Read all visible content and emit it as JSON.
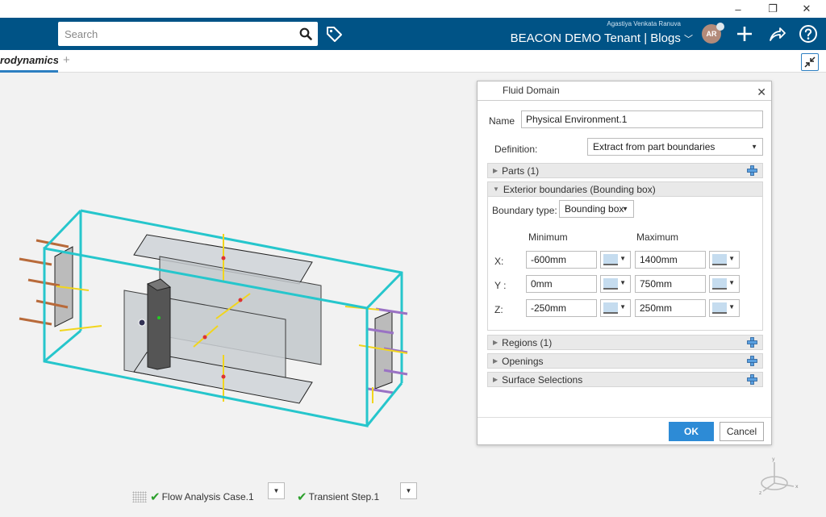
{
  "window": {
    "minimize": "–",
    "maximize": "❐",
    "close": "✕"
  },
  "topbar": {
    "search_placeholder": "Search",
    "user_name": "Agastiya Venkata Ranuva",
    "tenant": "BEACON DEMO Tenant | Blogs",
    "avatar_initials": "AR",
    "accent": "#005386"
  },
  "tabs": {
    "active_label": "rodynamics",
    "add_label": "+"
  },
  "dialog": {
    "title": "Fluid Domain",
    "name_label": "Name",
    "name_value": "Physical Environment.1",
    "definition_label": "Definition:",
    "definition_value": "Extract from part boundaries",
    "sections": {
      "parts": "Parts (1)",
      "exterior": "Exterior boundaries (Bounding box)",
      "regions": "Regions (1)",
      "openings": "Openings",
      "surfaces": "Surface Selections"
    },
    "boundary_type_label": "Boundary type:",
    "boundary_type_value": "Bounding box",
    "col_min": "Minimum",
    "col_max": "Maximum",
    "rows": [
      {
        "axis": "X:",
        "min": "-600mm",
        "max": "1400mm"
      },
      {
        "axis": "Y :",
        "min": "0mm",
        "max": "750mm"
      },
      {
        "axis": "Z:",
        "min": "-250mm",
        "max": "250mm"
      }
    ],
    "ok": "OK",
    "cancel": "Cancel"
  },
  "bottom": {
    "case_label": "Flow Analysis Case.1",
    "step_label": "Transient Step.1"
  },
  "compass_labels": {
    "y": "y",
    "x": "x",
    "z": "z"
  }
}
